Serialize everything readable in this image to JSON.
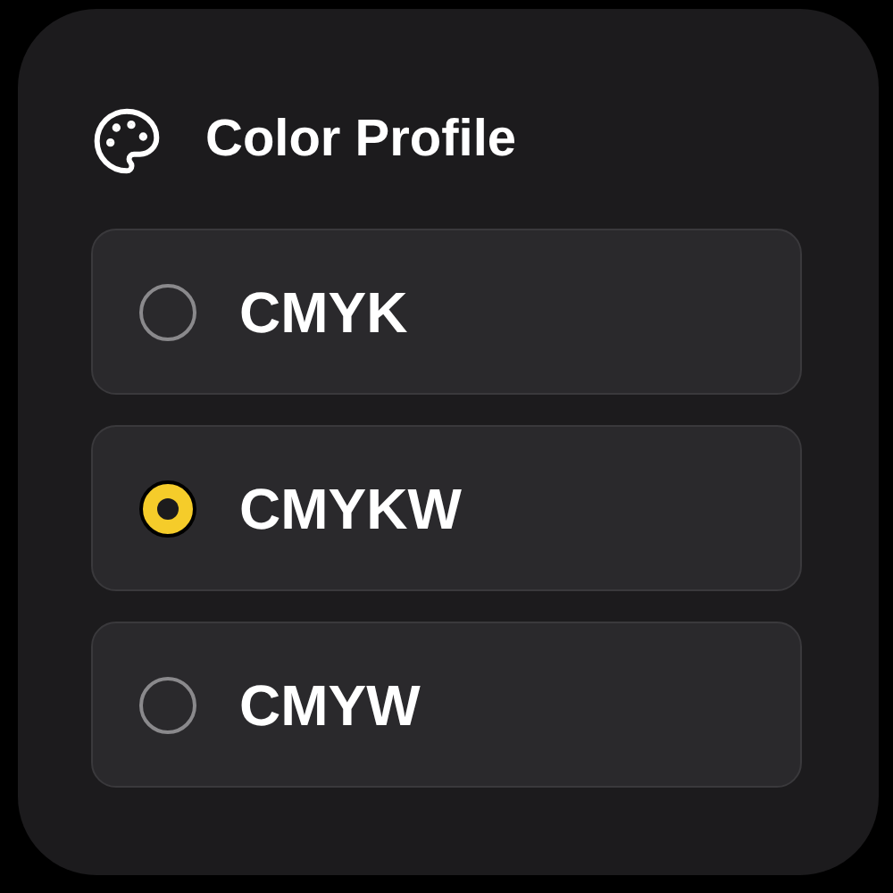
{
  "title": "Color Profile",
  "options": [
    {
      "label": "CMYK",
      "selected": false
    },
    {
      "label": "CMYKW",
      "selected": true
    },
    {
      "label": "CMYW",
      "selected": false
    }
  ]
}
